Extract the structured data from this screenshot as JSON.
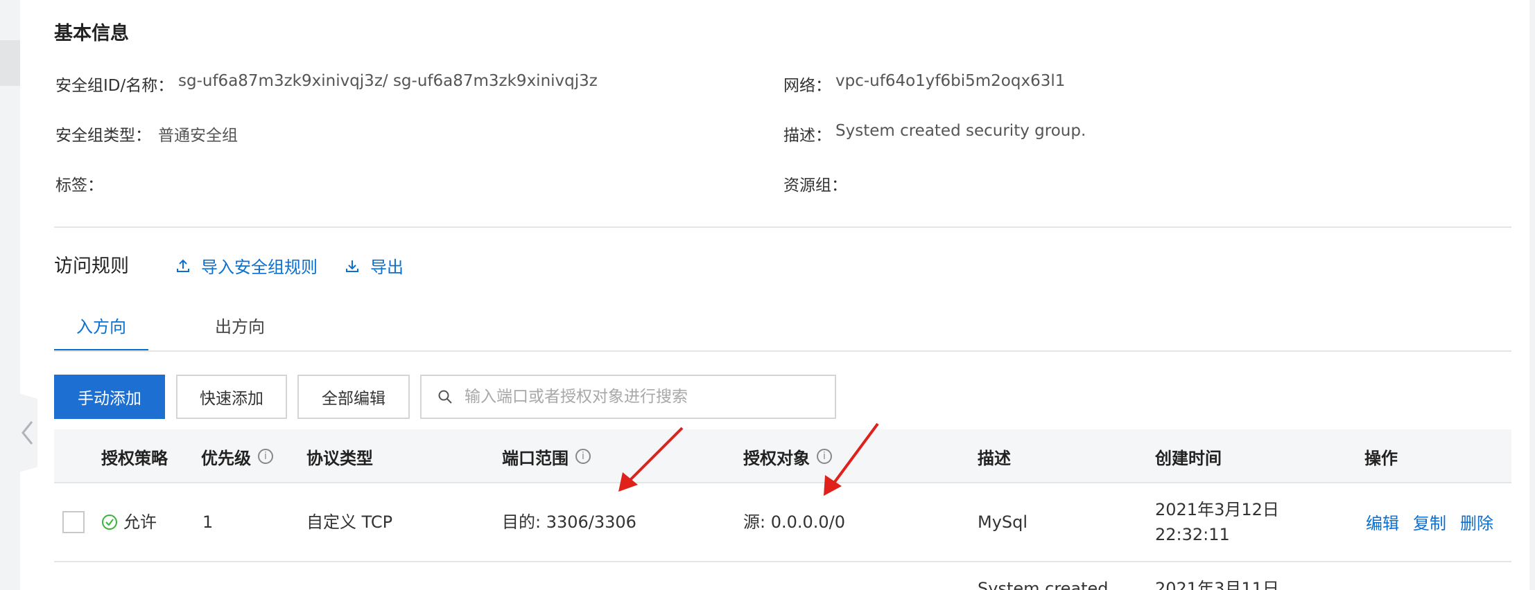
{
  "basic_info": {
    "title": "基本信息",
    "sg_id_label": "安全组ID/名称：",
    "sg_id_value": "sg-uf6a87m3zk9xinivqj3z/ sg-uf6a87m3zk9xinivqj3z",
    "network_label": "网络：",
    "network_value": "vpc-uf64o1yf6bi5m2oqx63l1",
    "sg_type_label": "安全组类型：",
    "sg_type_value": "普通安全组",
    "desc_label": "描述：",
    "desc_value": "System created security group.",
    "tags_label": "标签：",
    "resource_group_label": "资源组："
  },
  "access_rules": {
    "title": "访问规则",
    "import_label": "导入安全组规则",
    "export_label": "导出"
  },
  "tabs": [
    {
      "label": "入方向",
      "active": true
    },
    {
      "label": "出方向",
      "active": false
    }
  ],
  "toolbar": {
    "manual_add": "手动添加",
    "quick_add": "快速添加",
    "edit_all": "全部编辑",
    "search_placeholder": "输入端口或者授权对象进行搜索"
  },
  "table": {
    "columns": {
      "policy": "授权策略",
      "priority": "优先级",
      "protocol": "协议类型",
      "port_range": "端口范围",
      "auth_object": "授权对象",
      "description": "描述",
      "created": "创建时间",
      "actions": "操作"
    },
    "rows": [
      {
        "policy": "允许",
        "priority": "1",
        "protocol": "自定义 TCP",
        "port_range": "目的: 3306/3306",
        "auth_object": "源: 0.0.0.0/0",
        "description": "MySql",
        "created_date": "2021年3月12日",
        "created_time": "22:32:11",
        "action_edit": "编辑",
        "action_copy": "复制",
        "action_delete": "删除"
      },
      {
        "description": "System created",
        "created_date": "2021年3月11日"
      }
    ]
  },
  "colors": {
    "accent": "#0b6fcf",
    "primary_button": "#1d6fd2",
    "annotation_arrow": "#e0201b",
    "allow_green": "#3bb33b"
  }
}
